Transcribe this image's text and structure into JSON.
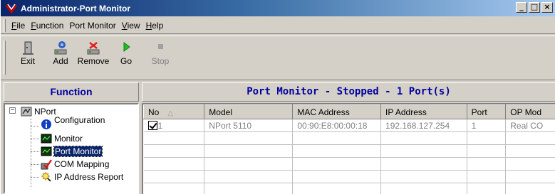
{
  "window": {
    "title": "Administrator-Port Monitor",
    "buttons": {
      "minimize": "_",
      "maximize": "□",
      "close": "×"
    }
  },
  "menu": {
    "items": [
      {
        "label": "File",
        "mnemonic": "F",
        "rest": "ile"
      },
      {
        "label": "Function",
        "mnemonic": "F",
        "rest": "unction"
      },
      {
        "label": "Port Monitor",
        "mnemonic": "",
        "rest": "Port Monitor"
      },
      {
        "label": "View",
        "mnemonic": "V",
        "rest": "iew"
      },
      {
        "label": "Help",
        "mnemonic": "H",
        "rest": "elp"
      }
    ]
  },
  "toolbar": {
    "exit": {
      "label": "Exit",
      "icon": "door-exit-icon"
    },
    "add": {
      "label": "Add",
      "icon": "add-device-icon"
    },
    "remove": {
      "label": "Remove",
      "icon": "remove-device-icon"
    },
    "go": {
      "label": "Go",
      "icon": "play-icon"
    },
    "stop": {
      "label": "Stop",
      "icon": "stop-icon",
      "enabled": false
    }
  },
  "left_panel": {
    "header": "Function",
    "tree": {
      "root": {
        "label": "NPort",
        "expander": "−"
      },
      "children": [
        {
          "label": "Configuration",
          "icon": "info-icon"
        },
        {
          "label": "Monitor",
          "icon": "monitor-icon"
        },
        {
          "label": "Port Monitor",
          "icon": "port-monitor-icon",
          "selected": true
        },
        {
          "label": "COM Mapping",
          "icon": "com-mapping-icon"
        },
        {
          "label": "IP Address Report",
          "icon": "ip-report-icon"
        }
      ]
    }
  },
  "right_panel": {
    "header": "Port Monitor - Stopped - 1 Port(s)",
    "columns": [
      "No",
      "Model",
      "MAC Address",
      "IP Address",
      "Port",
      "OP Mod"
    ],
    "rows": [
      {
        "checked": true,
        "no": "1",
        "model": "NPort 5110",
        "mac": "00:90:E8:00:00:18",
        "ip": "192.168.127.254",
        "port": "1",
        "op_mode": "Real CO"
      }
    ]
  },
  "colors": {
    "title_gradient_start": "#0a246a",
    "title_gradient_end": "#a6caf0",
    "panel_header_text": "#0000a0",
    "selection": "#0a246a",
    "chrome": "#d4d0c8"
  }
}
